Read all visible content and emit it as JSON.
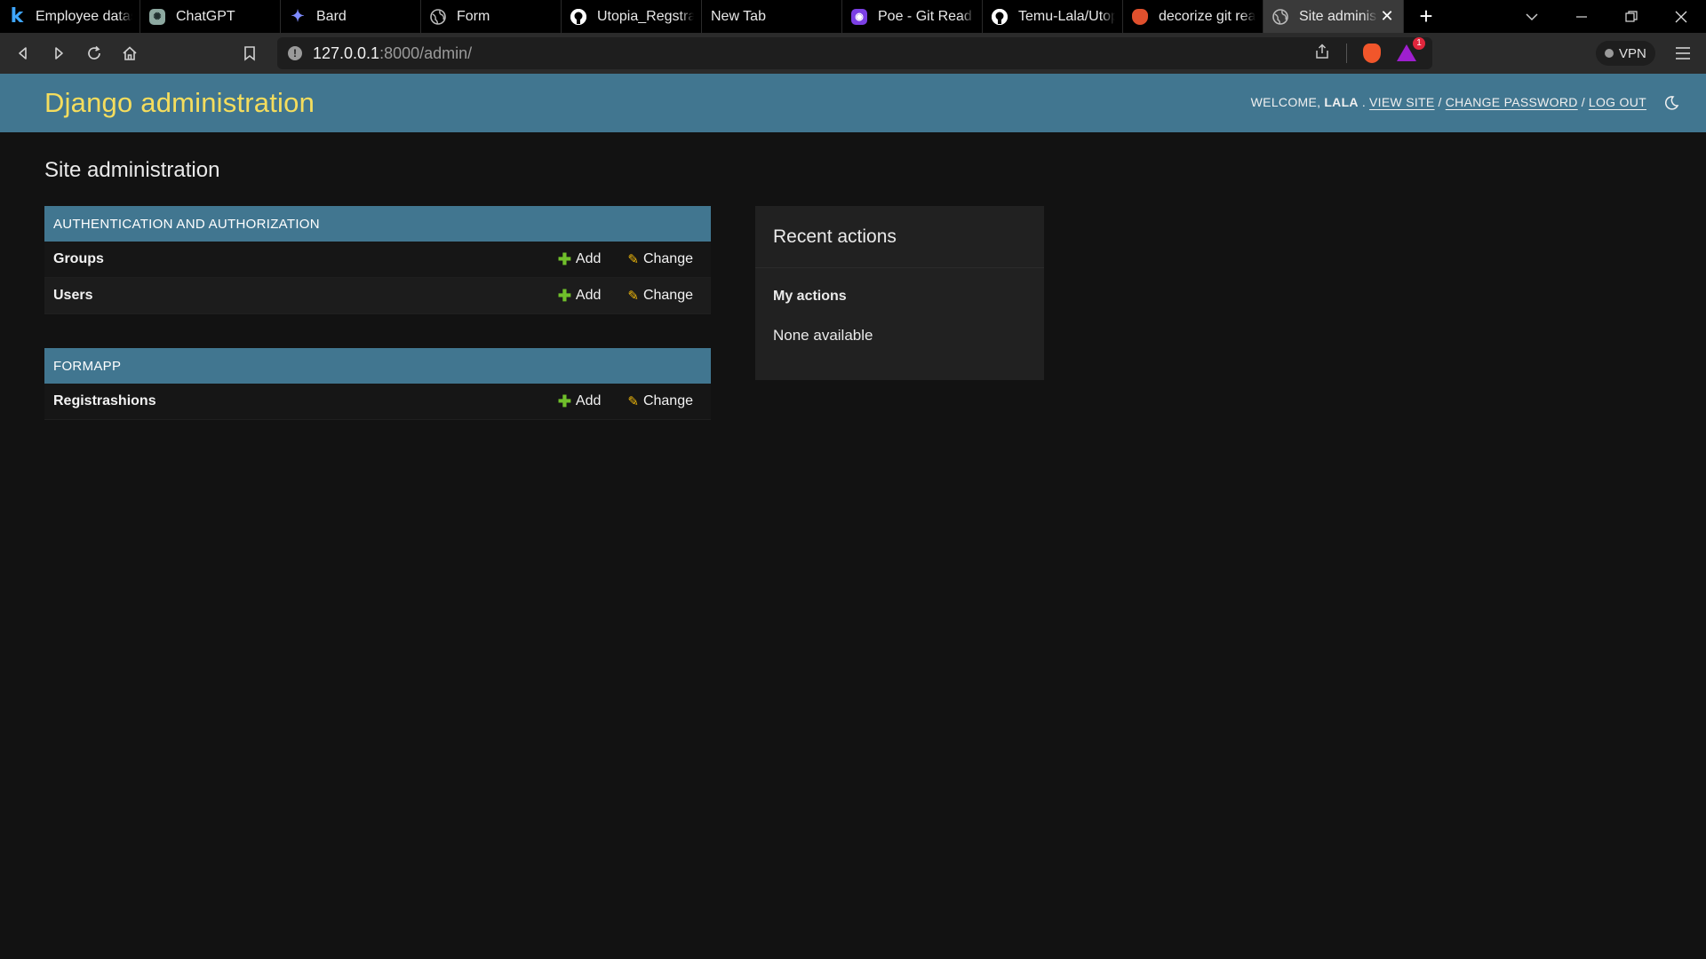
{
  "browser": {
    "tabs": [
      {
        "title": "Employee datase",
        "icon": "kaggle-icon"
      },
      {
        "title": "ChatGPT",
        "icon": "chatgpt-icon"
      },
      {
        "title": "Bard",
        "icon": "bard-icon"
      },
      {
        "title": "Form",
        "icon": "globe-icon"
      },
      {
        "title": "Utopia_Regstratio",
        "icon": "github-icon"
      },
      {
        "title": "New Tab",
        "icon": ""
      },
      {
        "title": "Poe - Git Read M",
        "icon": "poe-icon"
      },
      {
        "title": "Temu-Lala/Utopi",
        "icon": "github-icon"
      },
      {
        "title": "decorize git read",
        "icon": "brave-icon"
      },
      {
        "title": "Site adminis",
        "icon": "globe-icon",
        "active": true
      }
    ],
    "url_host": "127.0.0.1",
    "url_path": ":8000/admin/",
    "rewards_badge": "1",
    "vpn_label": "VPN"
  },
  "header": {
    "branding": "Django administration",
    "welcome": "WELCOME,",
    "username": "LALA",
    "view_site": "VIEW SITE",
    "change_password": "CHANGE PASSWORD",
    "log_out": "LOG OUT",
    "sep": "/"
  },
  "page_title": "Site administration",
  "apps": [
    {
      "caption": "AUTHENTICATION AND AUTHORIZATION",
      "models": [
        {
          "name": "Groups",
          "add": "Add",
          "change": "Change"
        },
        {
          "name": "Users",
          "add": "Add",
          "change": "Change"
        }
      ]
    },
    {
      "caption": "FORMAPP",
      "models": [
        {
          "name": "Registrashions",
          "add": "Add",
          "change": "Change"
        }
      ]
    }
  ],
  "recent_actions": {
    "title": "Recent actions",
    "subtitle": "My actions",
    "empty": "None available"
  },
  "colors": {
    "header_bg": "#417690",
    "branding": "#f5dd5d",
    "add_icon": "#70bf2b",
    "change_icon": "#efb80b",
    "body_bg": "#121212"
  }
}
